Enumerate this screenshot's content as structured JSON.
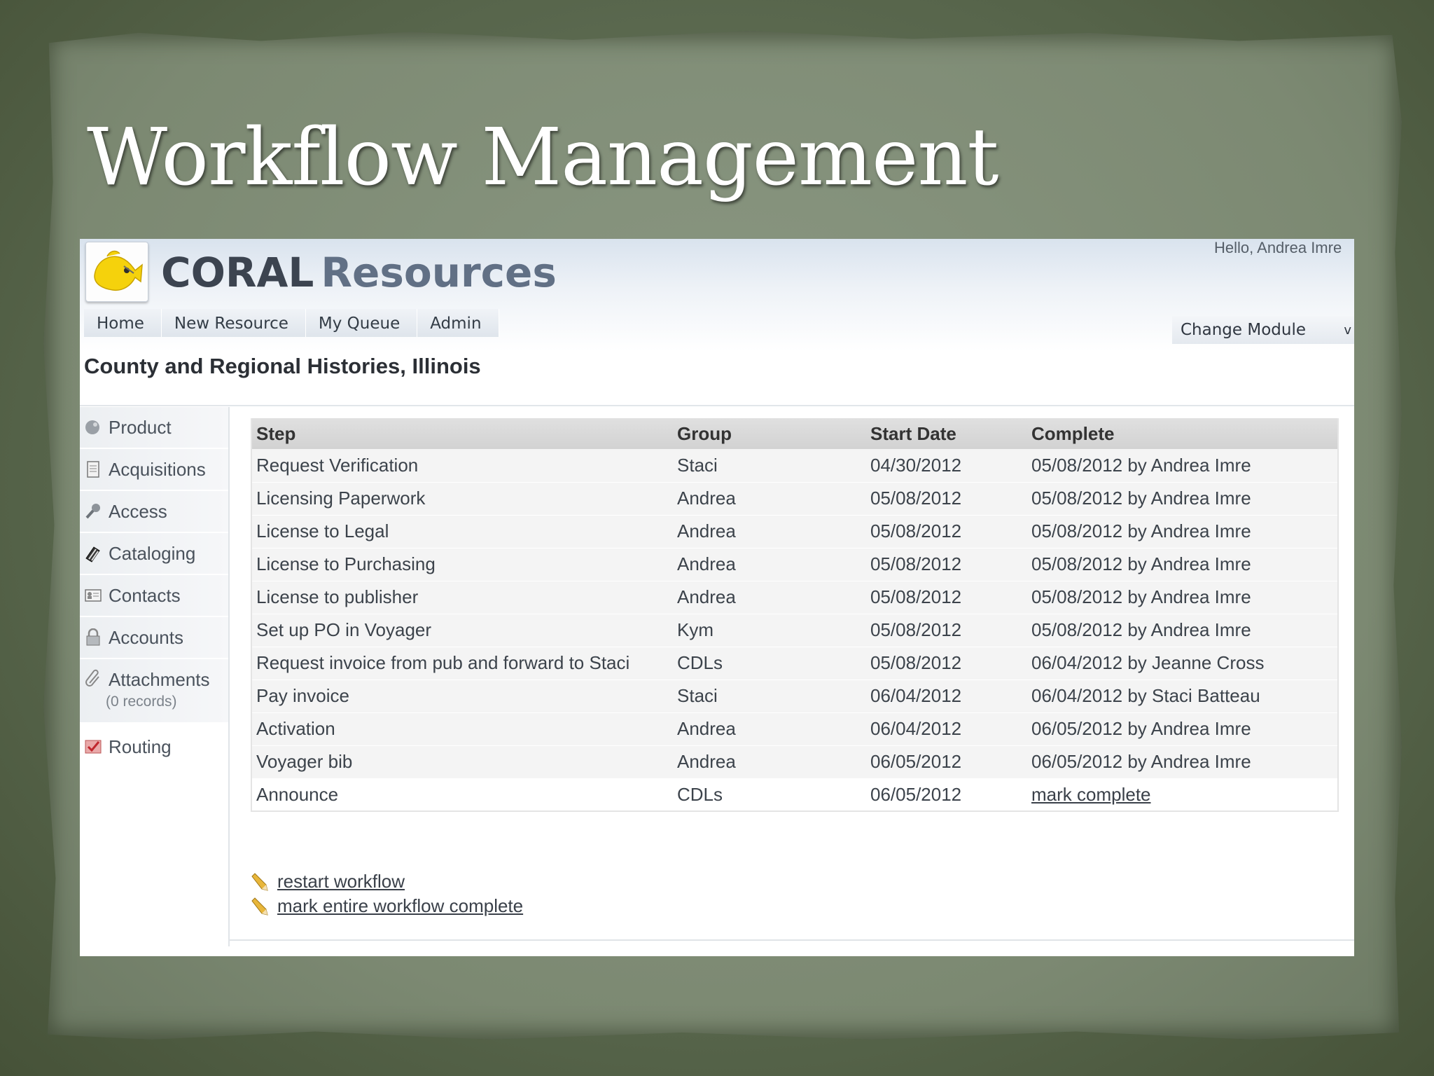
{
  "slide": {
    "title": "Workflow Management"
  },
  "app": {
    "brand_primary": "CORAL",
    "brand_secondary": "Resources",
    "greeting": "Hello, Andrea Imre",
    "nav": [
      {
        "label": "Home"
      },
      {
        "label": "New Resource"
      },
      {
        "label": "My Queue"
      },
      {
        "label": "Admin"
      }
    ],
    "change_module": {
      "label": "Change Module",
      "arrow": "v"
    },
    "resource_title": "County and Regional Histories, Illinois"
  },
  "sidebar": {
    "items": [
      {
        "label": "Product",
        "icon": "product-icon"
      },
      {
        "label": "Acquisitions",
        "icon": "acquisitions-icon"
      },
      {
        "label": "Access",
        "icon": "key-icon"
      },
      {
        "label": "Cataloging",
        "icon": "books-icon"
      },
      {
        "label": "Contacts",
        "icon": "contact-card-icon"
      },
      {
        "label": "Accounts",
        "icon": "lock-icon"
      },
      {
        "label": "Attachments",
        "sub": "(0 records)",
        "icon": "paperclip-icon"
      },
      {
        "label": "Routing",
        "icon": "routing-check-icon"
      }
    ]
  },
  "workflow": {
    "columns": [
      "Step",
      "Group",
      "Start Date",
      "Complete"
    ],
    "rows": [
      {
        "step": "Request Verification",
        "group": "Staci",
        "start": "04/30/2012",
        "complete": "05/08/2012 by Andrea Imre"
      },
      {
        "step": "Licensing Paperwork",
        "group": "Andrea",
        "start": "05/08/2012",
        "complete": "05/08/2012 by Andrea Imre"
      },
      {
        "step": "License to Legal",
        "group": "Andrea",
        "start": "05/08/2012",
        "complete": "05/08/2012 by Andrea Imre"
      },
      {
        "step": "License to Purchasing",
        "group": "Andrea",
        "start": "05/08/2012",
        "complete": "05/08/2012 by Andrea Imre"
      },
      {
        "step": "License to publisher",
        "group": "Andrea",
        "start": "05/08/2012",
        "complete": "05/08/2012 by Andrea Imre"
      },
      {
        "step": "Set up PO in Voyager",
        "group": "Kym",
        "start": "05/08/2012",
        "complete": "05/08/2012 by Andrea Imre"
      },
      {
        "step": "Request invoice from pub and forward to Staci",
        "group": "CDLs",
        "start": "05/08/2012",
        "complete": "06/04/2012 by Jeanne Cross"
      },
      {
        "step": "Pay invoice",
        "group": "Staci",
        "start": "06/04/2012",
        "complete": "06/04/2012 by Staci Batteau"
      },
      {
        "step": "Activation",
        "group": "Andrea",
        "start": "06/04/2012",
        "complete": "06/05/2012 by Andrea Imre"
      },
      {
        "step": "Voyager bib",
        "group": "Andrea",
        "start": "06/05/2012",
        "complete": "06/05/2012 by Andrea Imre"
      },
      {
        "step": "Announce",
        "group": "CDLs",
        "start": "06/05/2012",
        "complete": "mark complete"
      }
    ]
  },
  "actions": {
    "restart": "restart workflow",
    "mark_all": "mark entire workflow complete"
  },
  "colors": {
    "background": "#56644a",
    "paper": "#818e78",
    "header_gradient_top": "#d9e3ee",
    "fish": "#f5d20c"
  }
}
